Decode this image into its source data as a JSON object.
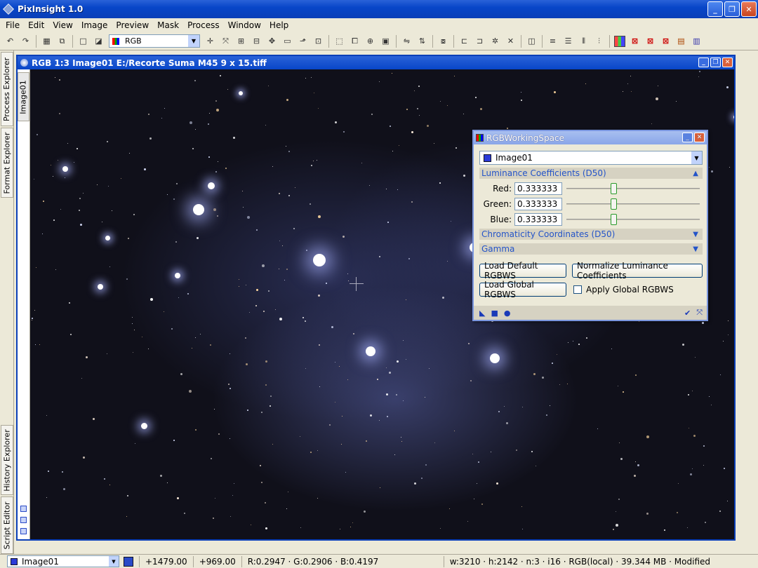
{
  "app": {
    "title": "PixInsight 1.0"
  },
  "window_buttons": {
    "minimize": "_",
    "maximize": "❐",
    "close": "✕"
  },
  "menu": [
    "File",
    "Edit",
    "View",
    "Image",
    "Preview",
    "Mask",
    "Process",
    "Window",
    "Help"
  ],
  "toolbar": {
    "color_space": "RGB"
  },
  "side_tabs": {
    "process_explorer": "Process Explorer",
    "format_explorer": "Format Explorer",
    "history_explorer": "History Explorer",
    "script_editor": "Script Editor"
  },
  "image_window": {
    "title": "RGB 1:3 Image01 E:/Recorte Suma M45 9 x 15.tiff",
    "tab_label": "Image01"
  },
  "dialog": {
    "title": "RGBWorkingSpace",
    "image": "Image01",
    "section_luminance": "Luminance Coefficients (D50)",
    "red_label": "Red:",
    "red_value": "0.333333",
    "red_level": 0.35,
    "green_label": "Green:",
    "green_value": "0.333333",
    "green_level": 0.35,
    "blue_label": "Blue:",
    "blue_value": "0.333333",
    "blue_level": 0.35,
    "section_chromaticity": "Chromaticity Coordinates (D50)",
    "section_gamma": "Gamma",
    "load_default": "Load Default RGBWS",
    "normalize": "Normalize Luminance Coefficients",
    "load_global": "Load Global RGBWS",
    "apply_global": "Apply Global RGBWS",
    "apply_global_checked": false
  },
  "status": {
    "view": "Image01",
    "x": "+1479.00",
    "y": "+969.00",
    "pixel": "R:0.2947 · G:0.2906 · B:0.4197",
    "info": "w:3210 · h:2142 · n:3 · i16 · RGB(local) · 39.344 MB · Modified"
  }
}
